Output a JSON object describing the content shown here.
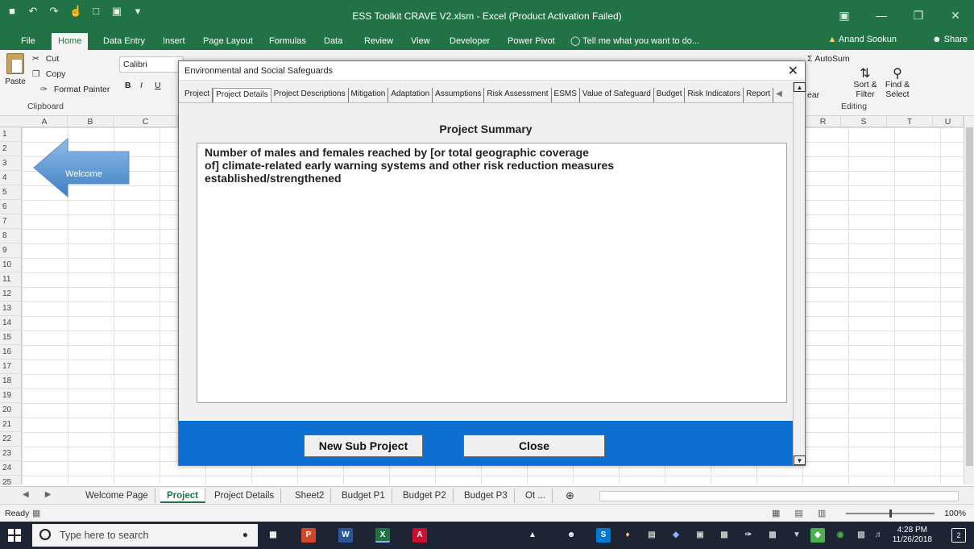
{
  "window": {
    "title": "ESS Toolkit CRAVE V2.xlsm - Excel (Product Activation Failed)",
    "quick_access": [
      "save-icon",
      "undo-icon",
      "redo-icon",
      "touch-icon",
      "new-icon",
      "preview-icon",
      "customize-icon"
    ]
  },
  "ribbon_tabs": [
    "File",
    "Home",
    "Data Entry",
    "Insert",
    "Page Layout",
    "Formulas",
    "Data",
    "Review",
    "View",
    "Developer",
    "Power Pivot"
  ],
  "tell_me": "Tell me what you want to do...",
  "user_name": "Anand Sookun",
  "share_label": "Share",
  "clipboard": {
    "paste": "Paste",
    "cut": "Cut",
    "copy": "Copy",
    "format_painter": "Format Painter",
    "group_label": "Clipboard"
  },
  "font": {
    "name": "Calibri",
    "bold": "B",
    "italic": "I",
    "underline": "U"
  },
  "editing": {
    "autosum": "AutoSum",
    "sort_filter": "Sort & Filter",
    "find_select": "Find & Select",
    "group_label": "Editing",
    "clear": "ear"
  },
  "columns_left": [
    "A",
    "B",
    "C"
  ],
  "columns_right": [
    "R",
    "S",
    "T",
    "U"
  ],
  "rows": [
    "1",
    "2",
    "3",
    "4",
    "5",
    "6",
    "7",
    "8",
    "9",
    "10",
    "11",
    "12",
    "13",
    "14",
    "15",
    "16",
    "17",
    "18",
    "19",
    "20",
    "21",
    "22",
    "23",
    "24",
    "25"
  ],
  "welcome_shape_label": "Welcome",
  "dialog": {
    "title": "Environmental and Social Safeguards",
    "tabs": [
      "Project",
      "Project Details",
      "Project Descriptions",
      "Mitigation",
      "Adaptation",
      "Assumptions",
      "Risk Assessment",
      "ESMS",
      "Value of Safeguard",
      "Budget",
      "Risk Indicators",
      "Report"
    ],
    "active_tab": "Project Details",
    "heading": "Project Summary",
    "text": "Number of males and females reached by [or total geographic coverage\nof] climate-related early warning systems and other risk reduction measures\nestablished/strengthened",
    "new_sub_project_label": "New Sub Project",
    "close_label": "Close"
  },
  "sheet_tabs": [
    "Welcome Page",
    "Project",
    "Project Details",
    "Sheet2",
    "Budget P1",
    "Budget P2",
    "Budget P3",
    "Ot ..."
  ],
  "active_sheet": "Project",
  "status": {
    "ready": "Ready",
    "zoom": "100%"
  },
  "taskbar": {
    "search_placeholder": "Type here to search",
    "time": "4:28 PM",
    "date": "11/26/2018",
    "notifications": "2"
  }
}
